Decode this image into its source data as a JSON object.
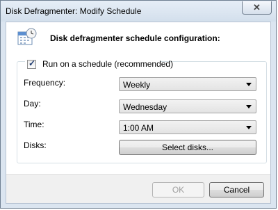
{
  "window": {
    "title": "Disk Defragmenter: Modify Schedule"
  },
  "header": {
    "icon": "calendar-clock-icon",
    "text": "Disk defragmenter schedule configuration:"
  },
  "schedule": {
    "run_on_schedule_label": "Run on a schedule (recommended)",
    "run_on_schedule_checked": true
  },
  "fields": {
    "frequency": {
      "label": "Frequency:",
      "value": "Weekly"
    },
    "day": {
      "label": "Day:",
      "value": "Wednesday"
    },
    "time": {
      "label": "Time:",
      "value": "1:00 AM"
    },
    "disks": {
      "label": "Disks:",
      "button_label": "Select disks..."
    }
  },
  "buttons": {
    "ok_label": "OK",
    "cancel_label": "Cancel"
  },
  "close_icon": "close-icon"
}
